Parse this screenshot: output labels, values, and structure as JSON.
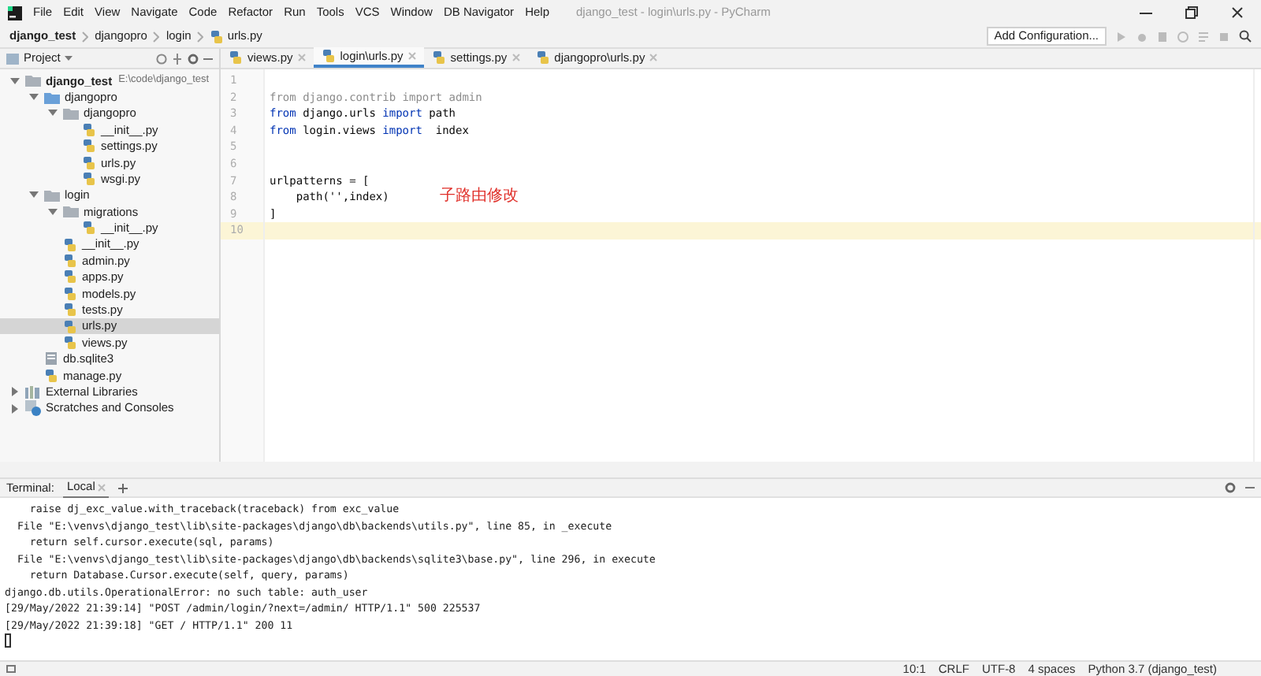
{
  "window": {
    "title": "django_test - login\\urls.py - PyCharm"
  },
  "menu": [
    "File",
    "Edit",
    "View",
    "Navigate",
    "Code",
    "Refactor",
    "Run",
    "Tools",
    "VCS",
    "Window",
    "DB Navigator",
    "Help"
  ],
  "breadcrumbs": [
    {
      "label": "django_test",
      "kind": "project"
    },
    {
      "label": "djangopro",
      "kind": "folder"
    },
    {
      "label": "login",
      "kind": "folder"
    },
    {
      "label": "urls.py",
      "kind": "file"
    }
  ],
  "run_config": {
    "label": "Add Configuration..."
  },
  "project_panel": {
    "title": "Project"
  },
  "tree": [
    {
      "label": "django_test",
      "path": "E:\\code\\django_test",
      "kind": "root",
      "expanded": true,
      "selected": false,
      "children": [
        {
          "label": "djangopro",
          "kind": "module",
          "expanded": true,
          "selected": false,
          "children": [
            {
              "label": "djangopro",
              "kind": "folder",
              "expanded": true,
              "selected": false,
              "children": [
                {
                  "label": "__init__.py",
                  "kind": "py",
                  "selected": false
                },
                {
                  "label": "settings.py",
                  "kind": "py",
                  "selected": false
                },
                {
                  "label": "urls.py",
                  "kind": "py",
                  "selected": false
                },
                {
                  "label": "wsgi.py",
                  "kind": "py",
                  "selected": false
                }
              ]
            }
          ]
        },
        {
          "label": "login",
          "kind": "folder",
          "expanded": true,
          "selected": false,
          "children": [
            {
              "label": "migrations",
              "kind": "folder",
              "expanded": true,
              "selected": false,
              "children": [
                {
                  "label": "__init__.py",
                  "kind": "py",
                  "selected": false
                }
              ]
            },
            {
              "label": "__init__.py",
              "kind": "py",
              "selected": false
            },
            {
              "label": "admin.py",
              "kind": "py",
              "selected": false
            },
            {
              "label": "apps.py",
              "kind": "py",
              "selected": false
            },
            {
              "label": "models.py",
              "kind": "py",
              "selected": false
            },
            {
              "label": "tests.py",
              "kind": "py",
              "selected": false
            },
            {
              "label": "urls.py",
              "kind": "py",
              "selected": true
            },
            {
              "label": "views.py",
              "kind": "py",
              "selected": false
            }
          ]
        },
        {
          "label": "db.sqlite3",
          "kind": "db",
          "selected": false
        },
        {
          "label": "manage.py",
          "kind": "py",
          "selected": false
        }
      ]
    },
    {
      "label": "External Libraries",
      "kind": "library",
      "expanded": false,
      "selected": false
    },
    {
      "label": "Scratches and Consoles",
      "kind": "scratch",
      "expanded": false,
      "selected": false
    }
  ],
  "editor_tabs": [
    {
      "label": "views.py",
      "selected": false
    },
    {
      "label": "login\\urls.py",
      "selected": true
    },
    {
      "label": "settings.py",
      "selected": false
    },
    {
      "label": "djangopro\\urls.py",
      "selected": false
    }
  ],
  "code": [
    {
      "number": "1",
      "current": false
    },
    {
      "number": "2",
      "current": false,
      "tokens": [
        {
          "text": "from django.contrib import admin",
          "kind": "unused"
        }
      ]
    },
    {
      "number": "3",
      "current": false,
      "tokens": [
        {
          "text": "from",
          "kind": "keyword"
        },
        {
          "text": " django.urls ",
          "kind": "plain"
        },
        {
          "text": "import",
          "kind": "keyword"
        },
        {
          "text": " path",
          "kind": "plain"
        }
      ]
    },
    {
      "number": "4",
      "current": false,
      "tokens": [
        {
          "text": "from",
          "kind": "keyword"
        },
        {
          "text": " login.views ",
          "kind": "plain"
        },
        {
          "text": "import",
          "kind": "keyword"
        },
        {
          "text": "  index",
          "kind": "plain"
        }
      ]
    },
    {
      "number": "5",
      "current": false
    },
    {
      "number": "6",
      "current": false
    },
    {
      "number": "7",
      "current": false,
      "tokens": [
        {
          "text": "urlpatterns = [",
          "kind": "plain"
        }
      ]
    },
    {
      "number": "8",
      "current": false,
      "tokens": [
        {
          "text": "    path('',index)",
          "kind": "plain"
        }
      ],
      "note": "子路由修改"
    },
    {
      "number": "9",
      "current": false,
      "tokens": [
        {
          "text": "]",
          "kind": "plain"
        }
      ]
    },
    {
      "number": "10",
      "current": true
    }
  ],
  "terminal": {
    "title": "Terminal:",
    "tabs": [
      {
        "label": "Local",
        "selected": true
      }
    ],
    "lines": [
      "    raise dj_exc_value.with_traceback(traceback) from exc_value",
      "  File \"E:\\venvs\\django_test\\lib\\site-packages\\django\\db\\backends\\utils.py\", line 85, in _execute",
      "    return self.cursor.execute(sql, params)",
      "  File \"E:\\venvs\\django_test\\lib\\site-packages\\django\\db\\backends\\sqlite3\\base.py\", line 296, in execute",
      "    return Database.Cursor.execute(self, query, params)",
      "django.db.utils.OperationalError: no such table: auth_user",
      "[29/May/2022 21:39:14] \"POST /admin/login/?next=/admin/ HTTP/1.1\" 500 225537",
      "[29/May/2022 21:39:18] \"GET / HTTP/1.1\" 200 11"
    ]
  },
  "status_bar": [
    "10:1",
    "CRLF",
    "UTF-8",
    "4 spaces",
    "Python 3.7 (django_test)"
  ]
}
